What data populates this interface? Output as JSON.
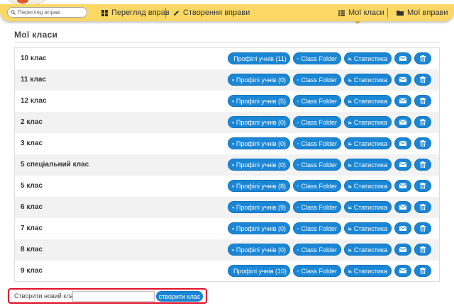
{
  "topbar": {
    "search_placeholder": "Перегляд вправ",
    "nav": {
      "browse_label": "Перегляд вправ",
      "create_label": "Створення вправи",
      "classes_label": "Мої класи",
      "exercises_label": "Мої вправи"
    },
    "active_item": "classes"
  },
  "page": {
    "title": "Мої класи"
  },
  "labels": {
    "profiles_prefix": "Профілі учнів",
    "folder": "Class Folder",
    "stats": "Статистика"
  },
  "classes": [
    {
      "name": "10 клас",
      "profiles": "Профілі учнів (11)"
    },
    {
      "name": "11 клас",
      "profiles": "Профілі учнів (0)"
    },
    {
      "name": "12 клас",
      "profiles": "Профілі учнів (5)"
    },
    {
      "name": "2 клас",
      "profiles": "Профілі учнів (0)"
    },
    {
      "name": "3 клас",
      "profiles": "Профілі учнів (0)"
    },
    {
      "name": "5 спеціальний клас",
      "profiles": "Профілі учнів (0)"
    },
    {
      "name": "5 клас",
      "profiles": "Профілі учнів (8)"
    },
    {
      "name": "6 клас",
      "profiles": "Профілі учнів (9)"
    },
    {
      "name": "7 клас",
      "profiles": "Профілі учнів (0)"
    },
    {
      "name": "8 клас",
      "profiles": "Профілі учнів (0)"
    },
    {
      "name": "9 клас",
      "profiles": "Профілі учнів (10)"
    }
  ],
  "new_class": {
    "label": "Створити новий клас:",
    "input_value": "",
    "button_label": "створити клас"
  },
  "colors": {
    "topbar": "#fbd865",
    "button": "#1a86d6",
    "highlight_border": "#e0102a",
    "row_alt": "#f2f2f2"
  },
  "icons": [
    "search-icon",
    "grid-icon",
    "pencil-icon",
    "list-icon",
    "folder-icon",
    "users-icon",
    "folder-open-icon",
    "bar-chart-icon",
    "envelope-icon",
    "trash-icon"
  ]
}
